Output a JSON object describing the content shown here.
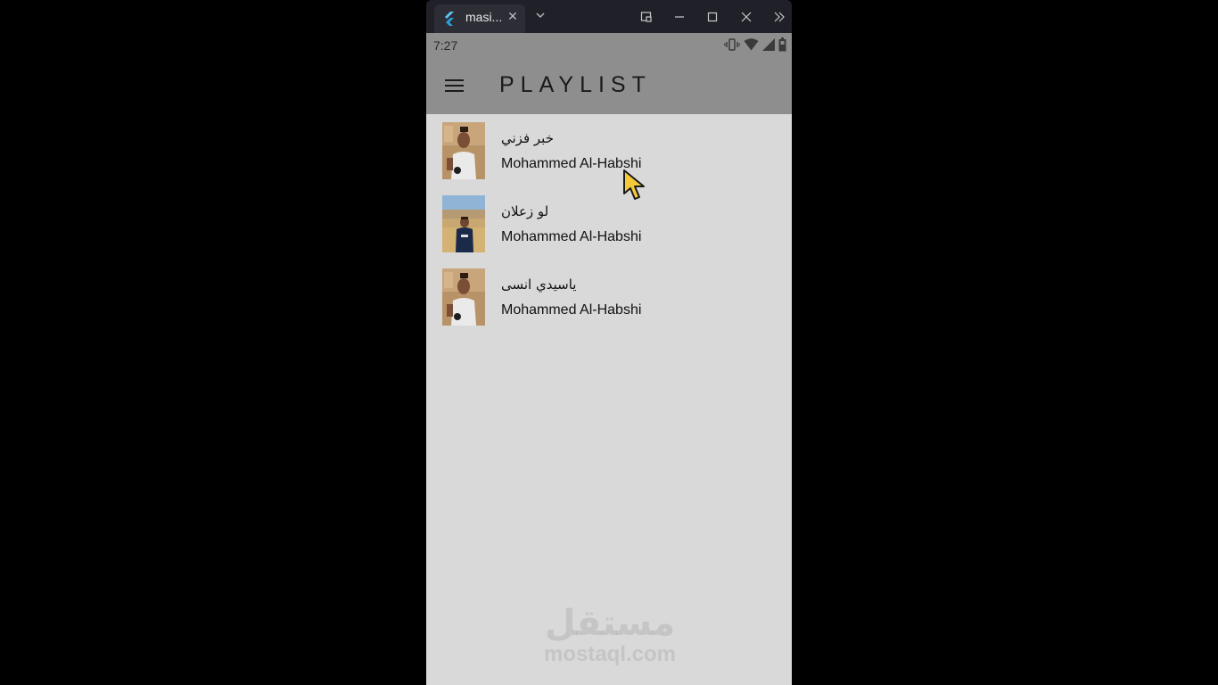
{
  "window": {
    "tab_title": "masi...",
    "tab_close": "✕"
  },
  "status_bar": {
    "time": "7:27"
  },
  "app_bar": {
    "title": "PLAYLIST"
  },
  "playlist": [
    {
      "title": "خبر فزني",
      "artist": "Mohammed Al-Habshi"
    },
    {
      "title": "لو زعلان",
      "artist": "Mohammed Al-Habshi"
    },
    {
      "title": "ياسيدي انسى",
      "artist": "Mohammed Al-Habshi"
    }
  ],
  "watermark": {
    "arabic": "مستقل",
    "latin": "mostaql.com"
  },
  "colors": {
    "app_bar": "#8e8e8e",
    "screen_bg": "#d9d9d9",
    "window_chrome": "#202028"
  }
}
